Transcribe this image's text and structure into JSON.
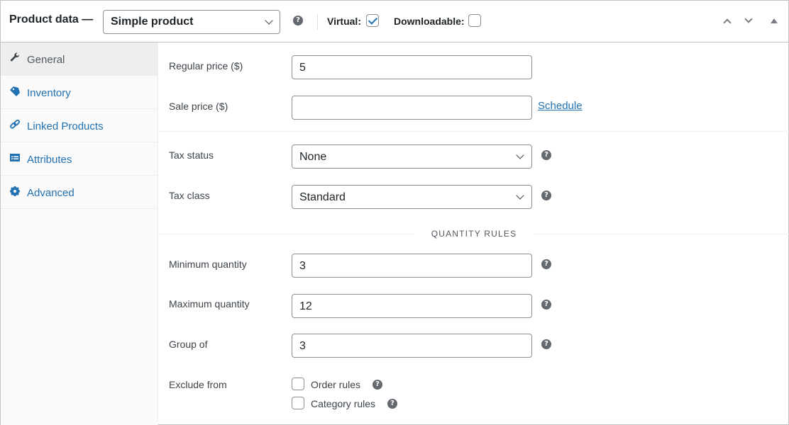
{
  "header": {
    "title": "Product data —",
    "product_type": "Simple product",
    "virtual_label": "Virtual:",
    "virtual_checked": true,
    "downloadable_label": "Downloadable:",
    "downloadable_checked": false,
    "help_glyph": "?"
  },
  "sidebar": {
    "items": [
      {
        "label": "General",
        "icon": "wrench-icon",
        "active": true
      },
      {
        "label": "Inventory",
        "icon": "tag-icon",
        "active": false
      },
      {
        "label": "Linked Products",
        "icon": "link-icon",
        "active": false
      },
      {
        "label": "Attributes",
        "icon": "list-icon",
        "active": false
      },
      {
        "label": "Advanced",
        "icon": "gear-icon",
        "active": false
      }
    ]
  },
  "general": {
    "regular_price": {
      "label": "Regular price ($)",
      "value": "5"
    },
    "sale_price": {
      "label": "Sale price ($)",
      "value": "",
      "schedule_link": "Schedule"
    },
    "tax_status": {
      "label": "Tax status",
      "value": "None"
    },
    "tax_class": {
      "label": "Tax class",
      "value": "Standard"
    }
  },
  "quantity_rules": {
    "title": "QUANTITY RULES",
    "minimum": {
      "label": "Minimum quantity",
      "value": "3"
    },
    "maximum": {
      "label": "Maximum quantity",
      "value": "12"
    },
    "group_of": {
      "label": "Group of",
      "value": "3"
    },
    "exclude_from": {
      "label": "Exclude from",
      "options": [
        {
          "label": "Order rules",
          "checked": false
        },
        {
          "label": "Category rules",
          "checked": false
        }
      ]
    }
  },
  "colors": {
    "accent": "#2271b1",
    "text": "#3c434a",
    "border": "#8c8f94"
  }
}
